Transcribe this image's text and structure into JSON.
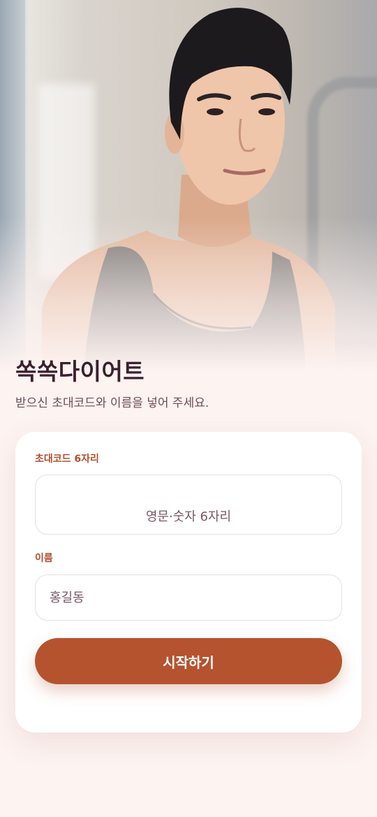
{
  "app": {
    "title": "쏙쏙다이어트",
    "subtitle": "받으신 초대코드와 이름을 넣어 주세요."
  },
  "form": {
    "code_label": "초대코드 6자리",
    "code_placeholder": "영문·숫자 6자리",
    "name_label": "이름",
    "name_placeholder": "홍길동",
    "submit_label": "시작하기"
  },
  "colors": {
    "accent": "#b5532f",
    "title": "#3b1f2e",
    "background": "#fdf3f1"
  }
}
